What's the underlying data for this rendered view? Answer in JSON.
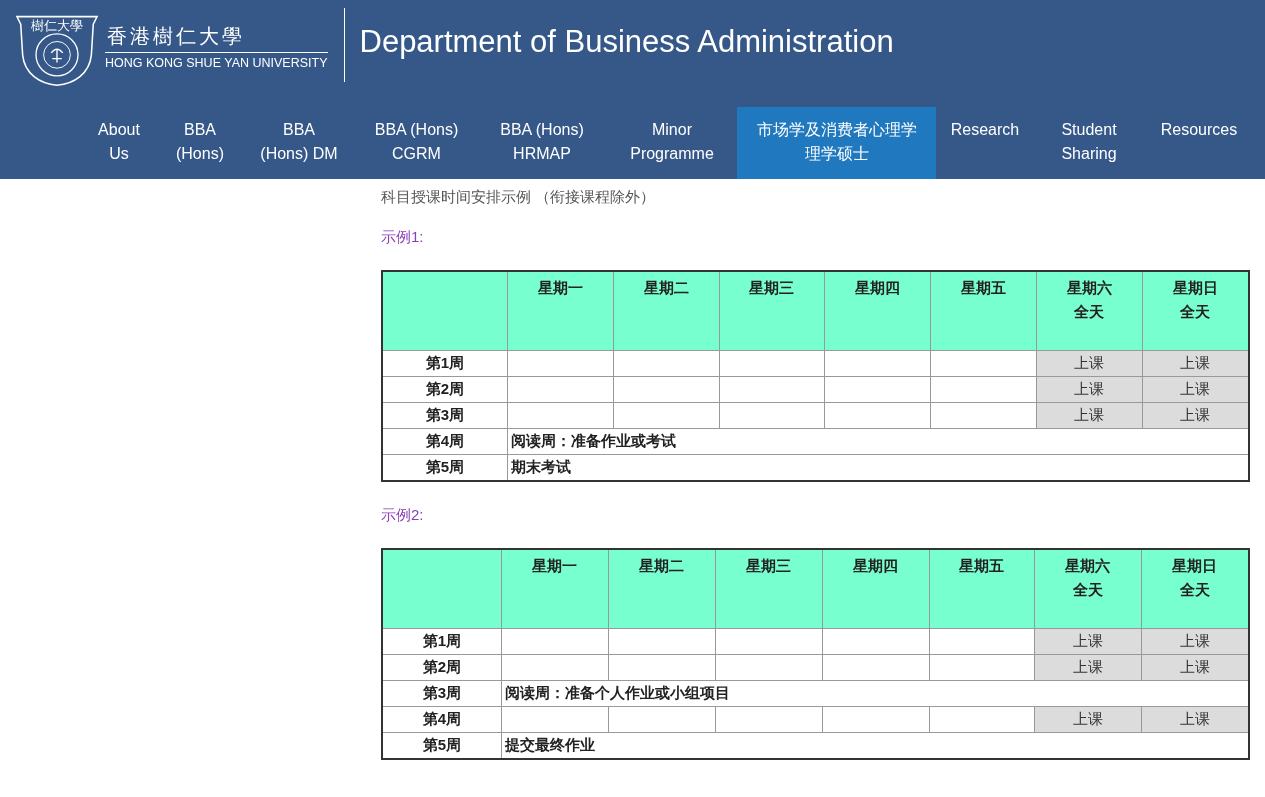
{
  "header": {
    "logo": {
      "badge": "樹仁大學",
      "name_zh": "香港樹仁大學",
      "name_en": "HONG KONG SHUE YAN UNIVERSITY"
    },
    "title": "Department of Business Administration"
  },
  "nav": [
    {
      "lines": [
        "About",
        "Us"
      ],
      "selected": false
    },
    {
      "lines": [
        "BBA",
        "(Hons)"
      ],
      "selected": false
    },
    {
      "lines": [
        "BBA",
        "(Hons) DM"
      ],
      "selected": false
    },
    {
      "lines": [
        "BBA (Hons)",
        "CGRM"
      ],
      "selected": false
    },
    {
      "lines": [
        "BBA (Hons)",
        "HRMAP"
      ],
      "selected": false
    },
    {
      "lines": [
        "Minor",
        "Programme"
      ],
      "selected": false
    },
    {
      "lines": [
        "市场学及消费者心理学",
        "理学硕士"
      ],
      "selected": true
    },
    {
      "lines": [
        "Research"
      ],
      "selected": false
    },
    {
      "lines": [
        "Student",
        "Sharing"
      ],
      "selected": false
    },
    {
      "lines": [
        "Resources"
      ],
      "selected": false
    }
  ],
  "intro": "科目授课时间安排示例 （衔接课程除外）",
  "examples": [
    {
      "label": "示例1:",
      "columns": [
        [
          "星期一"
        ],
        [
          "星期二"
        ],
        [
          "星期三"
        ],
        [
          "星期四"
        ],
        [
          "星期五"
        ],
        [
          "星期六",
          "全天"
        ],
        [
          "星期日",
          "全天"
        ]
      ],
      "rows": [
        {
          "week": "第1周",
          "kind": "days",
          "cells": [
            {
              "scheduled": false
            },
            {
              "scheduled": false
            },
            {
              "scheduled": false
            },
            {
              "scheduled": false
            },
            {
              "scheduled": false
            },
            {
              "scheduled": true,
              "text": "上课"
            },
            {
              "scheduled": true,
              "text": "上课"
            }
          ]
        },
        {
          "week": "第2周",
          "kind": "days",
          "cells": [
            {
              "scheduled": false
            },
            {
              "scheduled": false
            },
            {
              "scheduled": false
            },
            {
              "scheduled": false
            },
            {
              "scheduled": false
            },
            {
              "scheduled": true,
              "text": "上课"
            },
            {
              "scheduled": true,
              "text": "上课"
            }
          ]
        },
        {
          "week": "第3周",
          "kind": "days",
          "cells": [
            {
              "scheduled": false
            },
            {
              "scheduled": false
            },
            {
              "scheduled": false
            },
            {
              "scheduled": false
            },
            {
              "scheduled": false
            },
            {
              "scheduled": true,
              "text": "上课"
            },
            {
              "scheduled": true,
              "text": "上课"
            }
          ]
        },
        {
          "week": "第4周",
          "kind": "note",
          "text": "阅读周：准备作业或考试"
        },
        {
          "week": "第5周",
          "kind": "note",
          "text": "期末考试"
        }
      ]
    },
    {
      "label": "示例2:",
      "columns": [
        [
          "星期一"
        ],
        [
          "星期二"
        ],
        [
          "星期三"
        ],
        [
          "星期四"
        ],
        [
          "星期五"
        ],
        [
          "星期六",
          "全天"
        ],
        [
          "星期日",
          "全天"
        ]
      ],
      "rows": [
        {
          "week": "第1周",
          "kind": "days",
          "cells": [
            {
              "scheduled": false
            },
            {
              "scheduled": false
            },
            {
              "scheduled": false
            },
            {
              "scheduled": false
            },
            {
              "scheduled": false
            },
            {
              "scheduled": true,
              "text": "上课"
            },
            {
              "scheduled": true,
              "text": "上课"
            }
          ]
        },
        {
          "week": "第2周",
          "kind": "days",
          "cells": [
            {
              "scheduled": false
            },
            {
              "scheduled": false
            },
            {
              "scheduled": false
            },
            {
              "scheduled": false
            },
            {
              "scheduled": false
            },
            {
              "scheduled": true,
              "text": "上课"
            },
            {
              "scheduled": true,
              "text": "上课"
            }
          ]
        },
        {
          "week": "第3周",
          "kind": "note",
          "text": "阅读周：准备个人作业或小组项目"
        },
        {
          "week": "第4周",
          "kind": "days",
          "cells": [
            {
              "scheduled": false
            },
            {
              "scheduled": false
            },
            {
              "scheduled": false
            },
            {
              "scheduled": false
            },
            {
              "scheduled": false
            },
            {
              "scheduled": true,
              "text": "上课"
            },
            {
              "scheduled": true,
              "text": "上课"
            }
          ]
        },
        {
          "week": "第5周",
          "kind": "note",
          "text": "提交最终作业"
        }
      ]
    }
  ]
}
